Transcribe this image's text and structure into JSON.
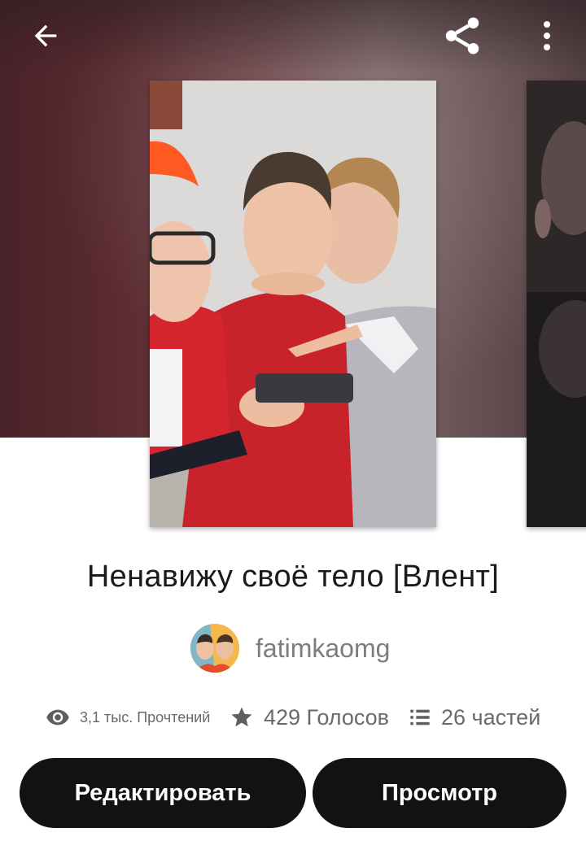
{
  "header": {
    "back_icon": "arrow-left-icon",
    "share_icon": "share-icon",
    "more_icon": "more-vertical-icon"
  },
  "story": {
    "title": "Ненавижу своё тело [Влент]",
    "author": "fatimkaomg"
  },
  "stats": {
    "reads": "3,1 тыс. Прочтений",
    "votes": "429 Голосов",
    "parts": "26 частей"
  },
  "actions": {
    "edit_label": "Редактировать",
    "view_label": "Просмотр"
  },
  "colors": {
    "button_bg": "#121212",
    "button_text": "#ffffff",
    "title_text": "#1a1a1a",
    "muted_text": "#6a6a6a"
  }
}
